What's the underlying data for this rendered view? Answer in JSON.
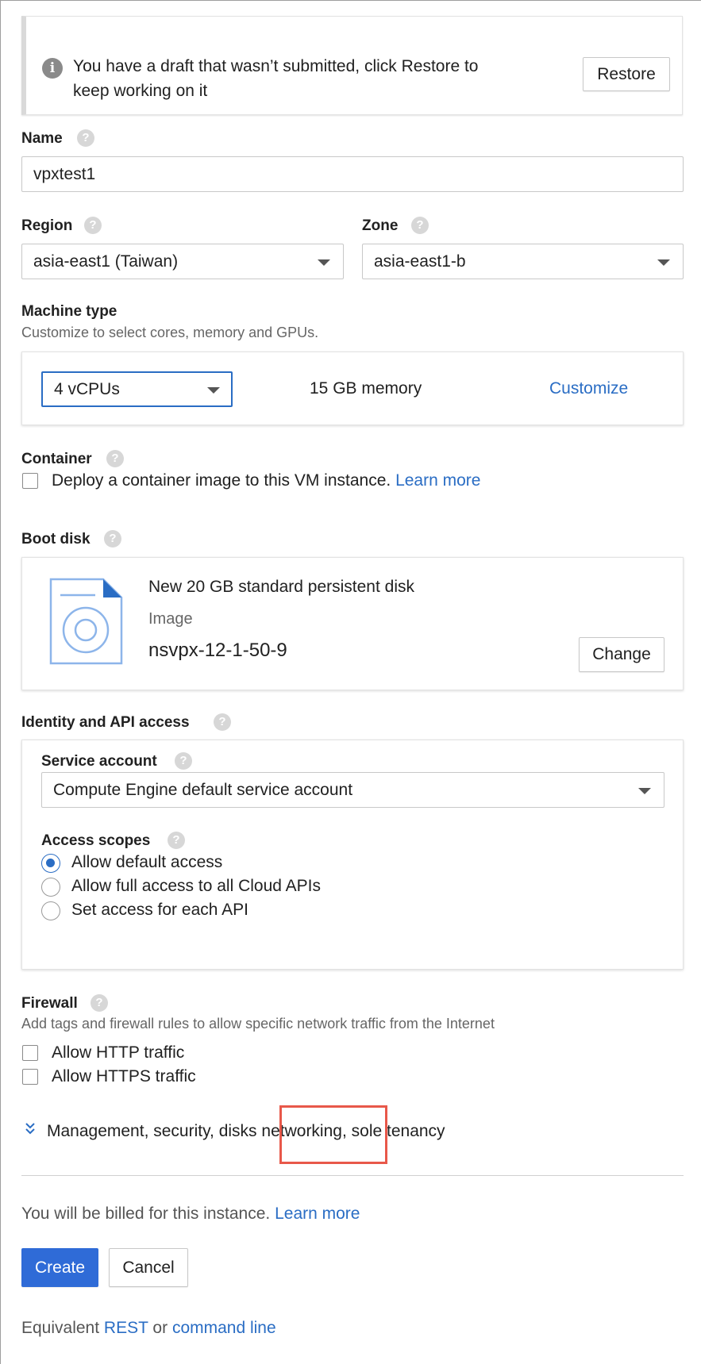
{
  "draft_banner": {
    "message_line1": "You have a draft that wasn’t submitted, click Restore to",
    "message_line2": "keep working on it",
    "restore_label": "Restore",
    "icon": "info-icon"
  },
  "name": {
    "label": "Name",
    "value": "vpxtest1"
  },
  "region": {
    "label": "Region",
    "value": "asia-east1 (Taiwan)"
  },
  "zone": {
    "label": "Zone",
    "value": "asia-east1-b"
  },
  "machine_type": {
    "label": "Machine type",
    "description": "Customize to select cores, memory and GPUs.",
    "cpus": "4 vCPUs",
    "memory": "15 GB memory",
    "customize_label": "Customize"
  },
  "container": {
    "label": "Container",
    "checkbox_label": "Deploy a container image to this VM instance.",
    "learn_more": "Learn more"
  },
  "boot_disk": {
    "label": "Boot disk",
    "title": "New 20 GB standard persistent disk",
    "image_label": "Image",
    "image_value": "nsvpx-12-1-50-9",
    "change_label": "Change",
    "icon": "disk-icon"
  },
  "identity": {
    "label": "Identity and API access",
    "service_account_label": "Service account",
    "service_account_value": "Compute Engine default service account",
    "access_scopes_label": "Access scopes",
    "scopes": [
      {
        "label": "Allow default access",
        "selected": true
      },
      {
        "label": "Allow full access to all Cloud APIs",
        "selected": false
      },
      {
        "label": "Set access for each API",
        "selected": false
      }
    ]
  },
  "firewall": {
    "label": "Firewall",
    "description": "Add tags and firewall rules to allow specific network traffic from the Internet",
    "http_label": "Allow HTTP traffic",
    "https_label": "Allow HTTPS traffic"
  },
  "expander": {
    "part1": "Management, security, disks",
    "part2": "networking,",
    "part3": "sole tenancy",
    "highlight_color": "#e8584a"
  },
  "billing": {
    "text": "You will be billed for this instance.",
    "learn_more": "Learn more"
  },
  "actions": {
    "create_label": "Create",
    "cancel_label": "Cancel"
  },
  "equivalent": {
    "prefix": "Equivalent",
    "rest": "REST",
    "or": "or",
    "command_line": "command line"
  },
  "colors": {
    "accent": "#2a6dc4",
    "primary_button": "#2f6bd7"
  }
}
